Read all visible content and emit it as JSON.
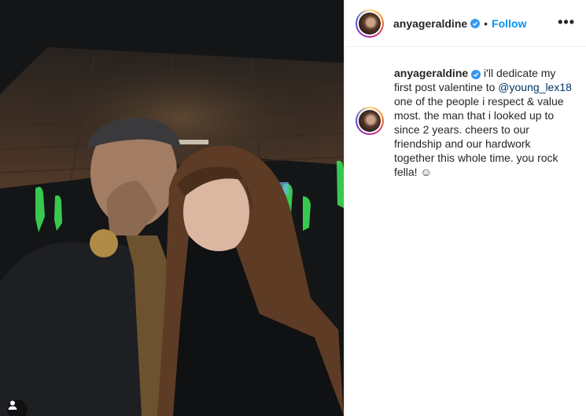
{
  "post": {
    "username": "anyageraldine",
    "verified": true,
    "follow_label": "Follow",
    "separator": "•",
    "more_label": "•••"
  },
  "caption": {
    "username": "anyageraldine",
    "text_before": " i'll dedicate my first post valentine to ",
    "mention": "@young_lex18",
    "text_after": " one of the people i respect & value most. the man that i looked up to since 2 years. cheers to our friendship and our hardwork together this whole time. you rock fella! ☺"
  },
  "photo": {
    "description_icon": "user-tag-icon",
    "colors": {
      "background": "#151617",
      "neon": "#3ddc57",
      "ceiling": "#6b4a33"
    }
  },
  "colors": {
    "accent": "#0095f6",
    "verified": "#3897f0",
    "text": "#262626"
  }
}
